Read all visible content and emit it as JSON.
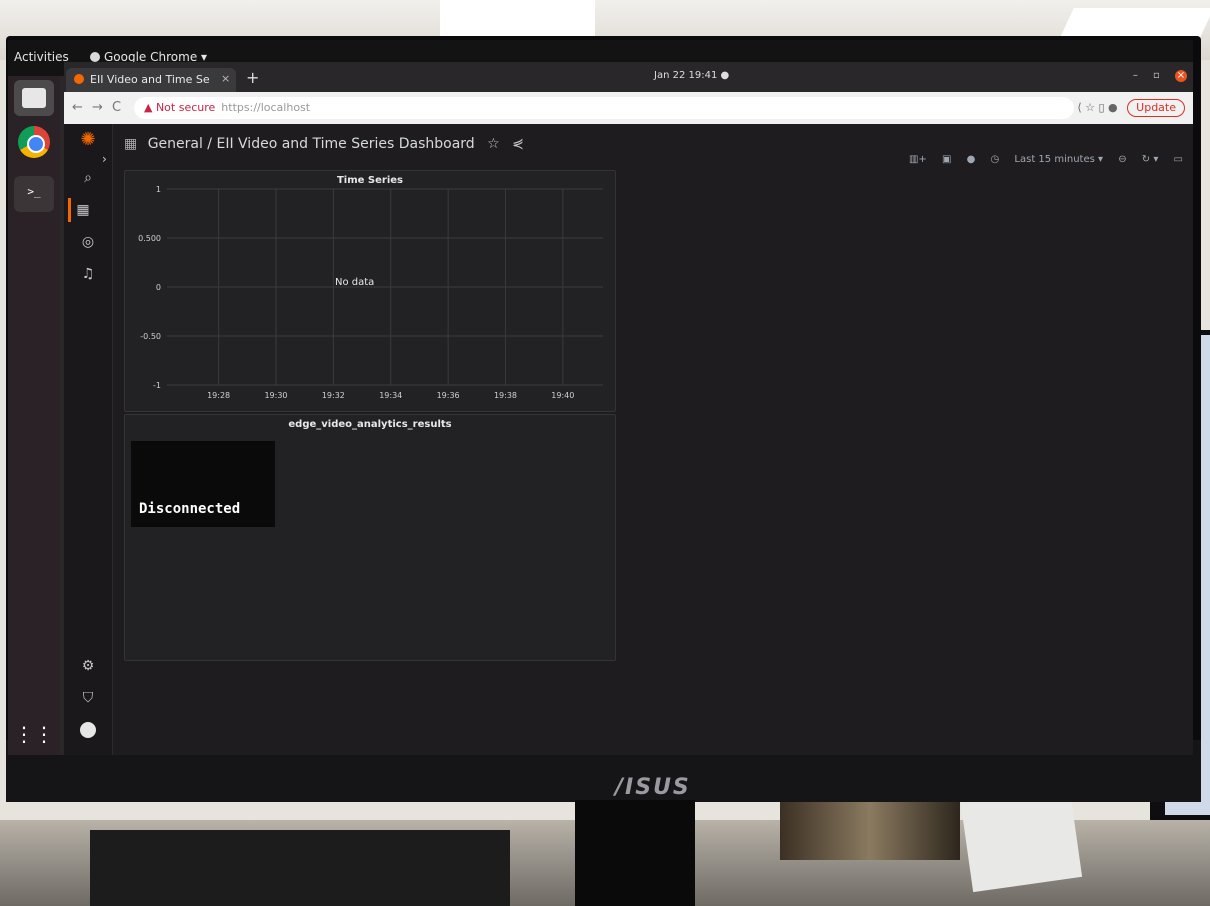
{
  "desktop": {
    "activities_label": "Activities",
    "app_menu_label": "Google Chrome ▾",
    "clock": "Jan 22  19:41  ●",
    "monitor_brand": "/ISUS"
  },
  "browser": {
    "tab_title": "EII Video and Time Serie",
    "tab_close": "×",
    "new_tab": "+",
    "nav_back": "←",
    "nav_forward": "→",
    "nav_reload": "C",
    "security_label": "▲ Not secure",
    "url": "https://localhost",
    "update_label": "Update"
  },
  "grafana": {
    "breadcrumb": "General  / EII Video and Time Series Dashboard",
    "time_range": "Last 15 minutes",
    "panels": [
      {
        "title": "Time Series",
        "no_data": "No data"
      },
      {
        "title": "edge_video_analytics_results",
        "video_status": "Disconnected"
      }
    ]
  },
  "chart_data": {
    "type": "line",
    "title": "Time Series",
    "x": [
      "19:28",
      "19:30",
      "19:32",
      "19:34",
      "19:36",
      "19:38",
      "19:40"
    ],
    "y_ticks": [
      "1",
      "0.500",
      "0",
      "-0.50",
      "-1"
    ],
    "ylim": [
      -1,
      1
    ],
    "series": [],
    "annotation": "No data",
    "grid": true
  }
}
